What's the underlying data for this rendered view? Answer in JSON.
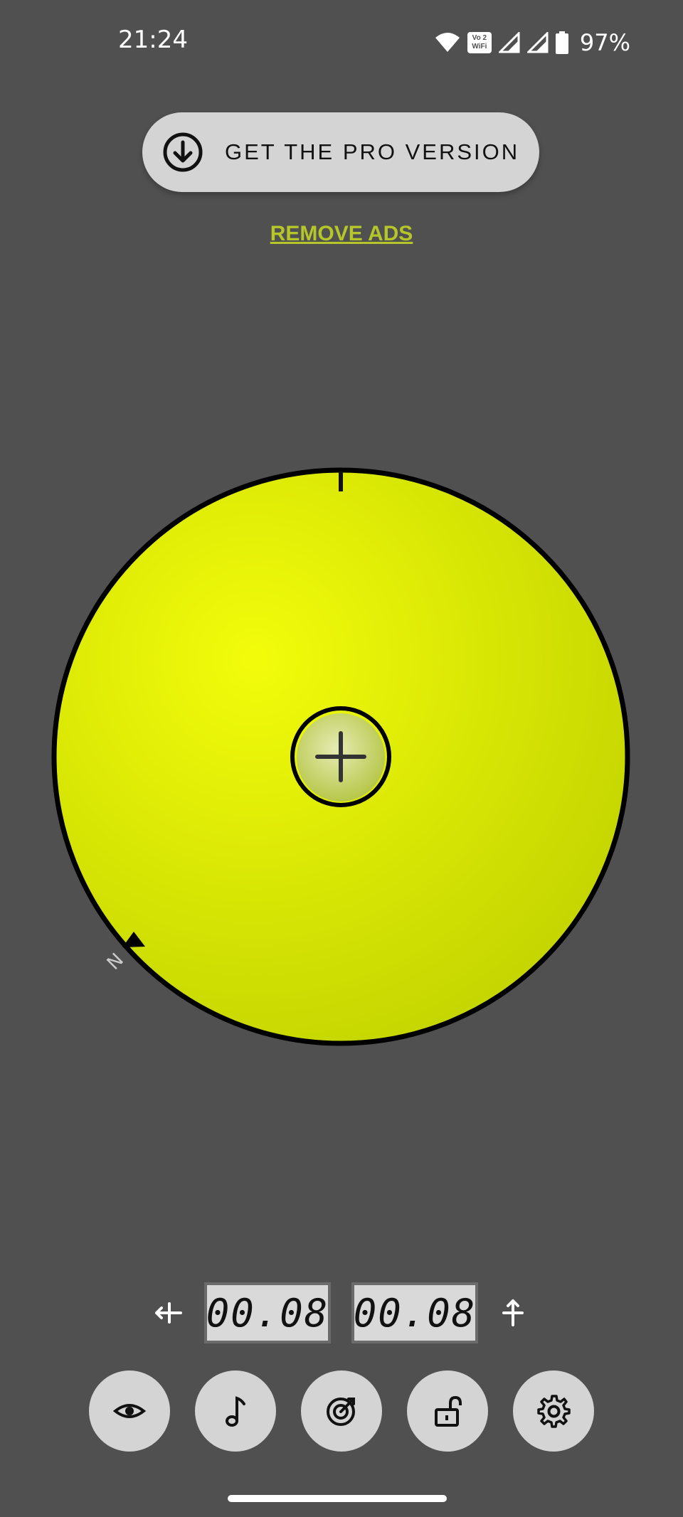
{
  "status_bar": {
    "time": "21:24",
    "battery": "97%",
    "vowifi": [
      "Vo 2",
      "WiFi"
    ],
    "icons": [
      "wifi-icon",
      "vowifi-icon",
      "signal-icon",
      "signal-icon",
      "battery-icon"
    ]
  },
  "promo": {
    "pro_label": "GET THE PRO VERSION",
    "remove_ads": "REMOVE ADS",
    "icon": "download-circle-icon"
  },
  "level": {
    "north_label": "N",
    "colors": {
      "fill_light": "#f2fc0a",
      "fill_dark": "#c3d400",
      "bubble": "#c9d66a",
      "ring": "#000000"
    }
  },
  "readouts": {
    "x_value": "00.08",
    "y_value": "00.08",
    "x_icon": "horizontal-axis-icon",
    "y_icon": "vertical-axis-icon"
  },
  "controls": [
    {
      "name": "visibility",
      "icon": "eye-icon"
    },
    {
      "name": "sound",
      "icon": "music-note-icon"
    },
    {
      "name": "calibrate",
      "icon": "target-icon"
    },
    {
      "name": "lock",
      "icon": "unlock-icon"
    },
    {
      "name": "settings",
      "icon": "gear-icon"
    }
  ]
}
